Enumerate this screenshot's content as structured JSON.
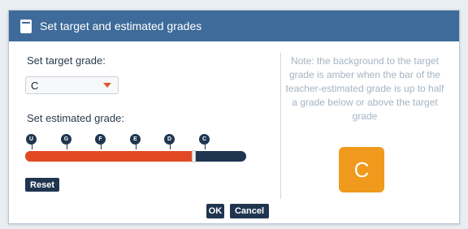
{
  "window": {
    "title": "Set target and estimated grades",
    "icon": "clipboard-icon"
  },
  "target": {
    "label": "Set target grade:",
    "selected": "C"
  },
  "estimated": {
    "label": "Set estimated grade:",
    "grades": [
      "U",
      "G",
      "F",
      "E",
      "D",
      "C"
    ],
    "level_percent": 76
  },
  "buttons": {
    "reset": "Reset",
    "ok": "OK",
    "cancel": "Cancel"
  },
  "note": "Note: the background to the target grade is amber when the bar of the teacher-estimated grade is up to half a grade below or above the target grade",
  "preview": {
    "grade": "C"
  },
  "colors": {
    "titlebar": "#3e6b99",
    "bar_fill": "#e24a24",
    "bar_track": "#1f3550",
    "amber": "#f09a1d",
    "caret": "#e0582a"
  }
}
